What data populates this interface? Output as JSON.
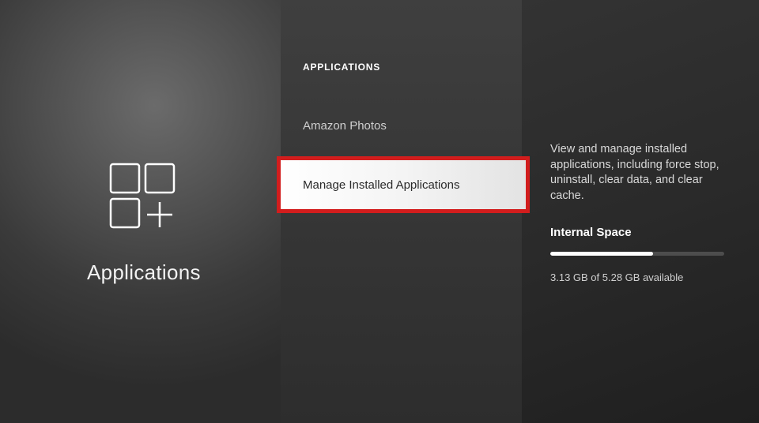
{
  "left": {
    "title": "Applications"
  },
  "mid": {
    "header": "APPLICATIONS",
    "items": [
      {
        "label": "Amazon Photos"
      },
      {
        "label": "Manage Installed Applications"
      }
    ]
  },
  "right": {
    "description": "View and manage installed applications, including force stop, uninstall, clear data, and clear cache.",
    "space_label": "Internal Space",
    "space_text": "3.13 GB of 5.28 GB available",
    "space_used_pct": 59
  }
}
